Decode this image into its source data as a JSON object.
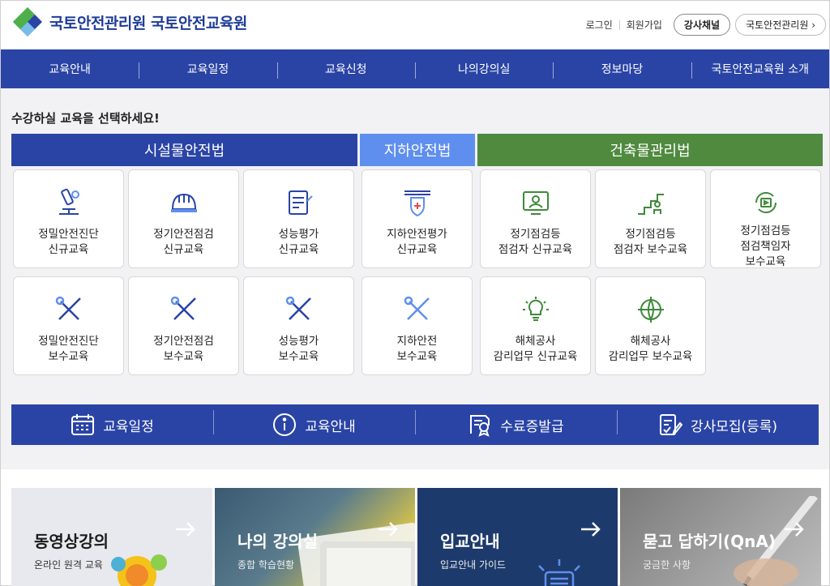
{
  "header": {
    "logo_text": "국토안전관리원 국토안전교육원",
    "login": "로그인",
    "join": "회원가입",
    "instructor_channel": "강사채널",
    "kalis_link": "국토안전관리원"
  },
  "gnb": [
    "교육안내",
    "교육일정",
    "교육신청",
    "나의강의실",
    "정보마당",
    "국토안전교육원 소개"
  ],
  "main": {
    "prompt": "수강하실 교육을 선택하세요!",
    "categories": [
      "시설물안전법",
      "지하안전법",
      "건축물관리법"
    ],
    "cards": [
      {
        "lines": [
          "정밀안전진단",
          "신규교육"
        ],
        "icon": "microscope-icon"
      },
      {
        "lines": [
          "정기안전점검",
          "신규교육"
        ],
        "icon": "hardhat-icon"
      },
      {
        "lines": [
          "성능평가",
          "신규교육"
        ],
        "icon": "document-icon"
      },
      {
        "lines": [
          "지하안전평가",
          "신규교육"
        ],
        "icon": "shield-icon"
      },
      {
        "lines": [
          "정기점검등",
          "점검자 신규교육"
        ],
        "icon": "monitor-user-icon"
      },
      {
        "lines": [
          "정기점검등",
          "점검자 보수교육"
        ],
        "icon": "stairs-person-icon"
      },
      {
        "lines": [
          "정기점검등",
          "점검책임자",
          "보수교육"
        ],
        "icon": "video-refresh-icon"
      },
      {
        "lines": [
          "정밀안전진단",
          "보수교육"
        ],
        "icon": "tools-icon"
      },
      {
        "lines": [
          "정기안전점검",
          "보수교육"
        ],
        "icon": "tools-icon"
      },
      {
        "lines": [
          "성능평가",
          "보수교육"
        ],
        "icon": "tools-icon"
      },
      {
        "lines": [
          "지하안전",
          "보수교육"
        ],
        "icon": "tools-icon"
      },
      {
        "lines": [
          "해체공사",
          "감리업무 신규교육"
        ],
        "icon": "lightbulb-icon"
      },
      {
        "lines": [
          "해체공사",
          "감리업무 보수교육"
        ],
        "icon": "globe-gear-icon"
      }
    ]
  },
  "quick": [
    {
      "label": "교육일정",
      "icon": "calendar-icon"
    },
    {
      "label": "교육안내",
      "icon": "info-icon"
    },
    {
      "label": "수료증발급",
      "icon": "certificate-icon"
    },
    {
      "label": "강사모집(등록)",
      "icon": "edit-document-icon"
    }
  ],
  "banners": [
    {
      "title": "동영상강의",
      "sub": "온라인 원격 교육"
    },
    {
      "title": "나의 강의실",
      "sub": "종합 학습현황"
    },
    {
      "title": "입교안내",
      "sub": "입교안내 가이드"
    },
    {
      "title": "묻고 답하기(QnA)",
      "sub": "궁금한 사항"
    }
  ],
  "colors": {
    "primary": "#2a44a6",
    "light_blue": "#5f8fee",
    "green": "#4f8a3f"
  }
}
